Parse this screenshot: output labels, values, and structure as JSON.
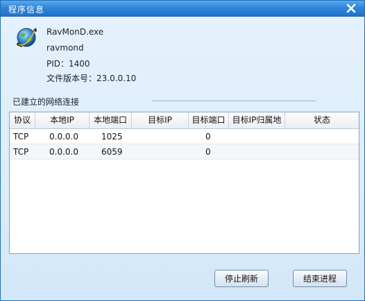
{
  "window": {
    "title": "程序信息"
  },
  "process": {
    "exe_name": "RavMonD.exe",
    "service_name": "ravmond",
    "pid_text": "PID：1400",
    "version_text": "文件版本号：23.0.0.10",
    "icon": "globe-shield-icon"
  },
  "connections": {
    "section_label": "已建立的网络连接",
    "columns": [
      "协议",
      "本地IP",
      "本地端口",
      "目标IP",
      "目标端口",
      "目标IP归属地",
      "状态"
    ],
    "rows": [
      [
        "TCP",
        "0.0.0.0",
        "1025",
        "",
        "0",
        "",
        ""
      ],
      [
        "TCP",
        "0.0.0.0",
        "6059",
        "",
        "0",
        "",
        ""
      ]
    ]
  },
  "buttons": {
    "stop_refresh": "停止刷新",
    "end_process": "结束进程"
  },
  "colors": {
    "titlebar": "#2f86d9",
    "window_bg": "#dcedfb",
    "border": "#1f6fb8"
  }
}
